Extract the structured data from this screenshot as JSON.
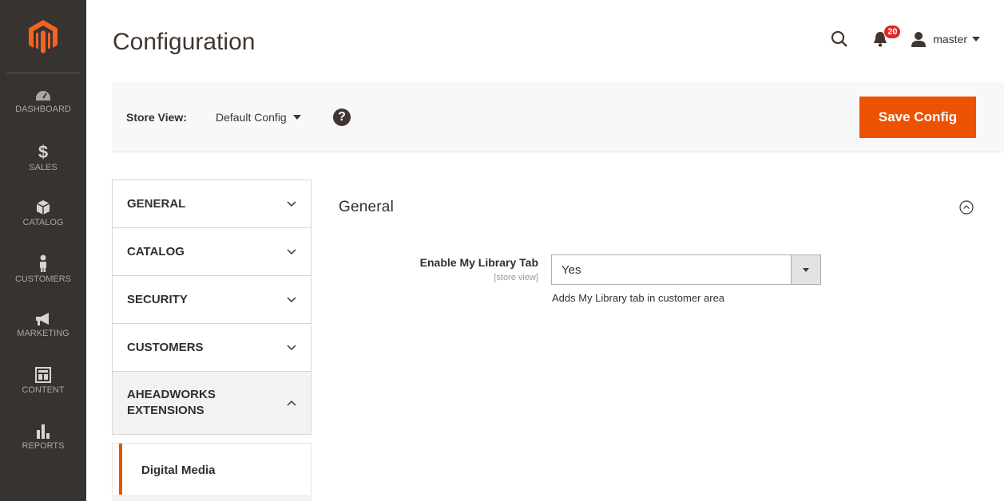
{
  "header": {
    "title": "Configuration",
    "notifications_count": "20",
    "user_name": "master"
  },
  "menu": {
    "items": [
      {
        "label": "DASHBOARD",
        "icon": "dashboard-icon"
      },
      {
        "label": "SALES",
        "icon": "dollar-icon"
      },
      {
        "label": "CATALOG",
        "icon": "box-icon"
      },
      {
        "label": "CUSTOMERS",
        "icon": "person-icon"
      },
      {
        "label": "MARKETING",
        "icon": "megaphone-icon"
      },
      {
        "label": "CONTENT",
        "icon": "layout-icon"
      },
      {
        "label": "REPORTS",
        "icon": "bar-chart-icon"
      }
    ]
  },
  "store_bar": {
    "label": "Store View:",
    "current": "Default Config",
    "help": "?",
    "save_label": "Save Config"
  },
  "tabs": {
    "items": [
      {
        "label": "GENERAL",
        "open": false
      },
      {
        "label": "CATALOG",
        "open": false
      },
      {
        "label": "SECURITY",
        "open": false
      },
      {
        "label": "CUSTOMERS",
        "open": false
      },
      {
        "label": "AHEADWORKS EXTENSIONS",
        "open": true
      }
    ],
    "sub_item": "Digital Media"
  },
  "section": {
    "title": "General",
    "field": {
      "label": "Enable My Library Tab",
      "scope": "[store view]",
      "value": "Yes",
      "note": "Adds My Library tab in customer area"
    }
  },
  "colors": {
    "accent": "#eb5202",
    "menu_bg": "#373330",
    "badge": "#e22626"
  }
}
